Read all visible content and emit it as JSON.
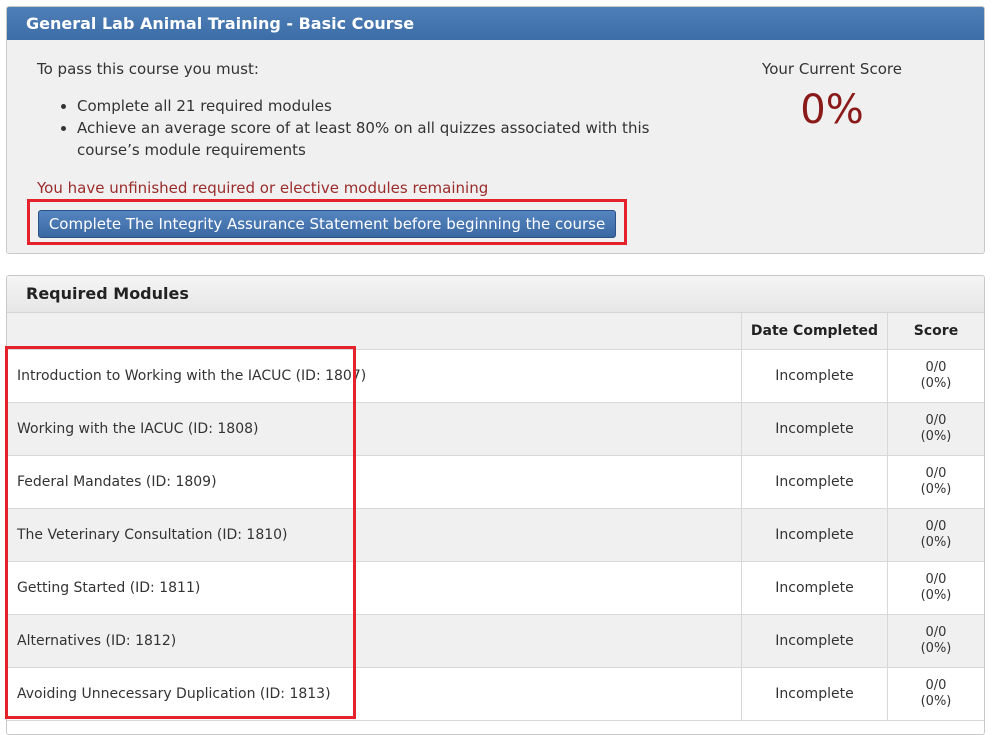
{
  "course": {
    "title": "General Lab Animal Training - Basic Course",
    "pass_intro": "To pass this course you must:",
    "requirements": [
      "Complete all 21 required modules",
      "Achieve an average score of at least 80% on all quizzes associated with this course’s module requirements"
    ],
    "warning": "You have unfinished required or elective modules remaining",
    "ias_button": "Complete The Integrity Assurance Statement before beginning the course",
    "score_label": "Your Current Score",
    "score_value": "0%"
  },
  "required_modules": {
    "heading": "Required Modules",
    "columns": [
      "",
      "Date Completed",
      "Score"
    ],
    "rows": [
      {
        "name": "Introduction to Working with the IACUC (ID: 1807)",
        "date": "Incomplete",
        "score": "0/0",
        "pct": "(0%)"
      },
      {
        "name": "Working with the IACUC (ID: 1808)",
        "date": "Incomplete",
        "score": "0/0",
        "pct": "(0%)"
      },
      {
        "name": "Federal Mandates (ID: 1809)",
        "date": "Incomplete",
        "score": "0/0",
        "pct": "(0%)"
      },
      {
        "name": "The Veterinary Consultation (ID: 1810)",
        "date": "Incomplete",
        "score": "0/0",
        "pct": "(0%)"
      },
      {
        "name": "Getting Started (ID: 1811)",
        "date": "Incomplete",
        "score": "0/0",
        "pct": "(0%)"
      },
      {
        "name": "Alternatives (ID: 1812)",
        "date": "Incomplete",
        "score": "0/0",
        "pct": "(0%)"
      },
      {
        "name": "Avoiding Unnecessary Duplication (ID: 1813)",
        "date": "Incomplete",
        "score": "0/0",
        "pct": "(0%)"
      }
    ]
  }
}
